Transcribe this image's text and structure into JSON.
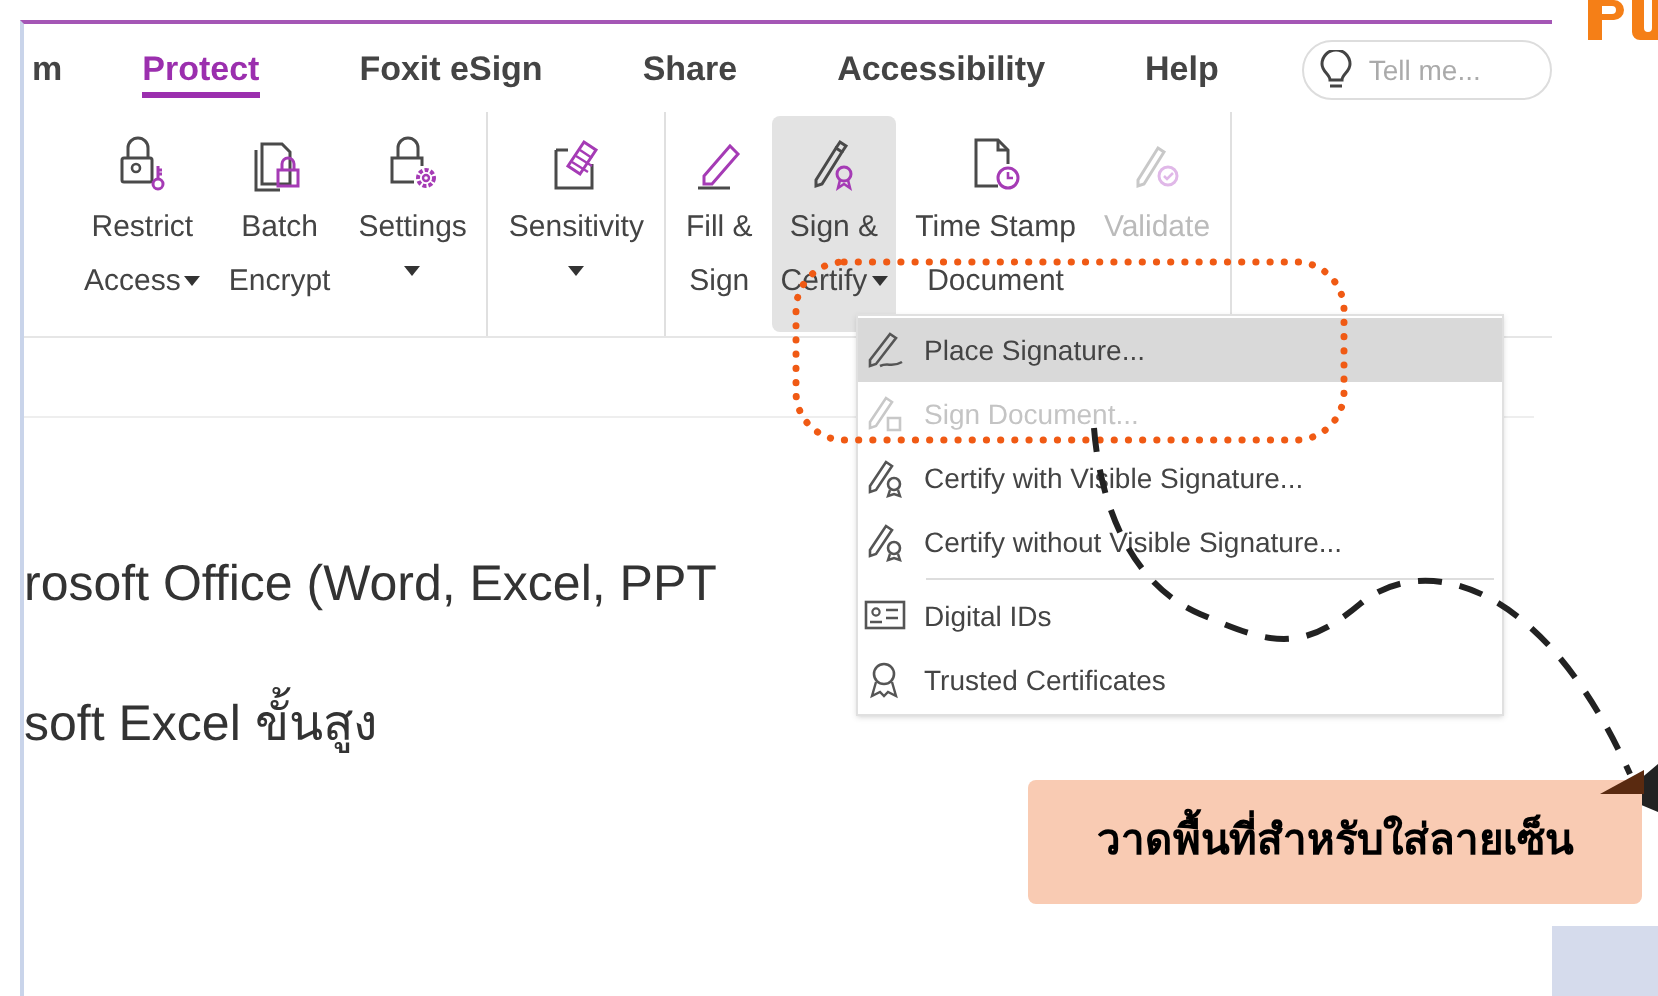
{
  "tabs": [
    {
      "label": "m",
      "selected": false
    },
    {
      "label": "Protect",
      "selected": true
    },
    {
      "label": "Foxit eSign",
      "selected": false
    },
    {
      "label": "Share",
      "selected": false
    },
    {
      "label": "Accessibility",
      "selected": false
    },
    {
      "label": "Help",
      "selected": false
    }
  ],
  "search": {
    "placeholder": "Tell me..."
  },
  "ribbon_groups": [
    {
      "buttons": [
        {
          "lines": [
            "Restrict",
            "Access"
          ],
          "dropdown": true,
          "disabled": false,
          "pressed": false
        },
        {
          "lines": [
            "Batch",
            "Encrypt"
          ],
          "dropdown": false,
          "disabled": false,
          "pressed": false
        },
        {
          "lines": [
            "Settings"
          ],
          "dropdown": true,
          "disabled": false,
          "pressed": false
        }
      ]
    },
    {
      "buttons": [
        {
          "lines": [
            "Sensitivity"
          ],
          "dropdown": true,
          "disabled": false,
          "pressed": false
        }
      ]
    },
    {
      "buttons": [
        {
          "lines": [
            "Fill &",
            "Sign"
          ],
          "dropdown": false,
          "disabled": false,
          "pressed": false
        },
        {
          "lines": [
            "Sign &",
            "Certify"
          ],
          "dropdown": true,
          "disabled": false,
          "pressed": true
        },
        {
          "lines": [
            "Time Stamp",
            "Document"
          ],
          "dropdown": false,
          "disabled": false,
          "pressed": false
        },
        {
          "lines": [
            "Validate"
          ],
          "dropdown": false,
          "disabled": true,
          "pressed": false
        }
      ]
    }
  ],
  "document_lines": [
    "rosoft Office (Word, Excel, PPT",
    "soft Excel ขั้นสูง"
  ],
  "menu": [
    {
      "label": "Place Signature...",
      "selected": true,
      "disabled": false,
      "separator_before": false
    },
    {
      "label": "Sign Document...",
      "selected": false,
      "disabled": true,
      "separator_before": false
    },
    {
      "label": "Certify with Visible Signature...",
      "selected": false,
      "disabled": false,
      "separator_before": false
    },
    {
      "label": "Certify without Visible Signature...",
      "selected": false,
      "disabled": false,
      "separator_before": false
    },
    {
      "label": "Digital IDs",
      "selected": false,
      "disabled": false,
      "separator_before": true
    },
    {
      "label": "Trusted Certificates",
      "selected": false,
      "disabled": false,
      "separator_before": false
    }
  ],
  "callout": {
    "text": "วาดพื้นที่สำหรับใส่ลายเซ็น"
  }
}
